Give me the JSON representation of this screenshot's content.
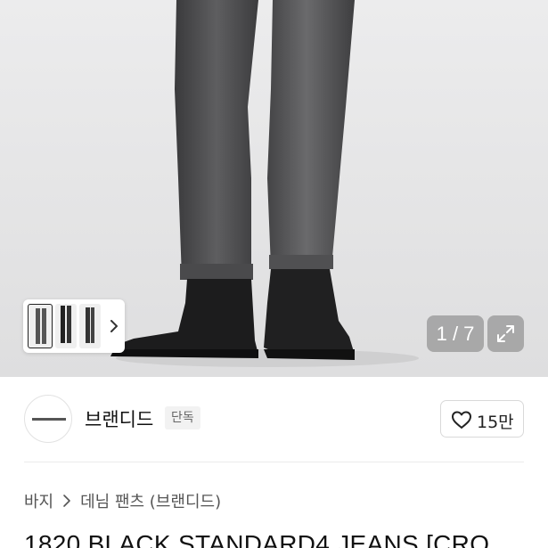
{
  "gallery": {
    "counter": "1 / 7",
    "expand_icon": "expand-arrows-icon",
    "thumbnail_next_icon": "chevron-right-icon"
  },
  "brand": {
    "name": "브랜디드",
    "tag": "단독",
    "like_icon": "heart-outline-icon",
    "like_count": "15만"
  },
  "breadcrumb": {
    "items": [
      "바지",
      "데님 팬츠 (브랜디드)"
    ],
    "separator_icon": "chevron-right-icon"
  },
  "product": {
    "title": "1820 BLACK STANDARD4 JEANS [CRO"
  }
}
